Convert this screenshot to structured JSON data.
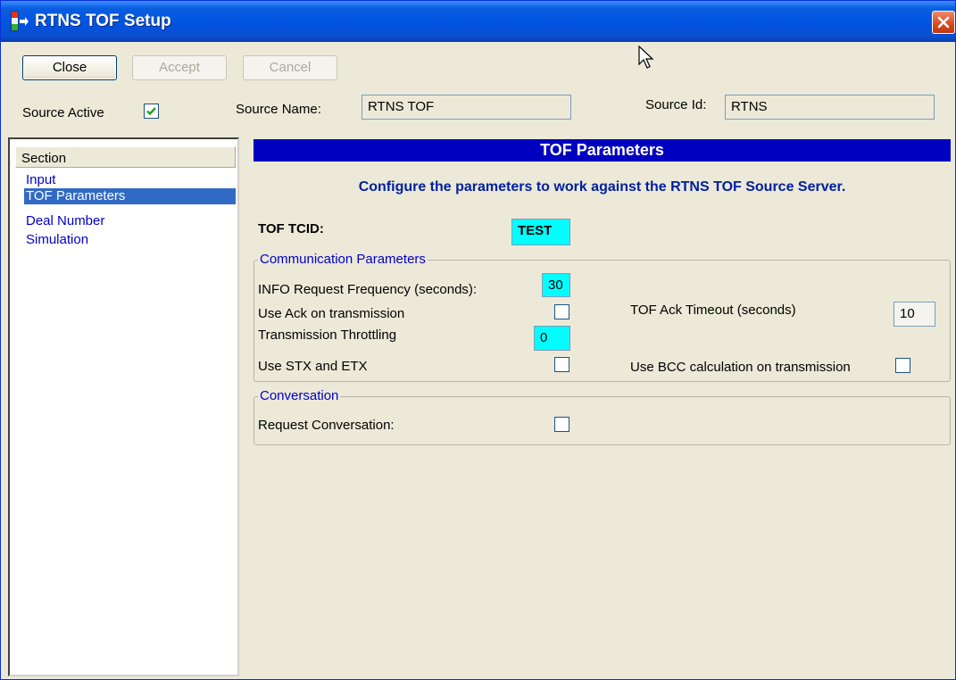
{
  "window": {
    "title": "RTNS TOF Setup",
    "close_glyph": "×"
  },
  "toolbar": {
    "close_label": "Close",
    "accept_label": "Accept",
    "cancel_label": "Cancel"
  },
  "source": {
    "active_label": "Source Active",
    "active_checked": true,
    "name_label": "Source Name:",
    "name_value": "RTNS TOF",
    "id_label": "Source Id:",
    "id_value": "RTNS"
  },
  "sections": {
    "header": "Section",
    "items": [
      {
        "label": "Input",
        "selected": false
      },
      {
        "label": "TOF Parameters",
        "selected": true
      },
      {
        "label": "Deal Number",
        "selected": false
      },
      {
        "label": "Simulation",
        "selected": false
      }
    ]
  },
  "main": {
    "header": "TOF Parameters",
    "subtitle": "Configure the parameters to work against the RTNS TOF Source Server.",
    "tcid_label": "TOF TCID:",
    "tcid_value": "TEST",
    "comm_group": {
      "legend": "Communication Parameters",
      "info_freq_label": "INFO Request Frequency (seconds):",
      "info_freq_value": "30",
      "use_ack_label": "Use Ack on transmission",
      "use_ack_checked": false,
      "ack_timeout_label": "TOF Ack Timeout (seconds)",
      "ack_timeout_value": "10",
      "throttling_label": "Transmission Throttling",
      "throttling_value": "0",
      "stx_etx_label": "Use STX and ETX",
      "stx_etx_checked": false,
      "bcc_label": "Use BCC calculation on transmission",
      "bcc_checked": false
    },
    "conv_group": {
      "legend": "Conversation",
      "request_label": "Request Conversation:",
      "request_checked": false
    }
  },
  "colors": {
    "title_bar": "#0053e1",
    "header_blue": "#0000c0",
    "highlight_cyan": "#00ffff",
    "selection": "#316ac5"
  }
}
